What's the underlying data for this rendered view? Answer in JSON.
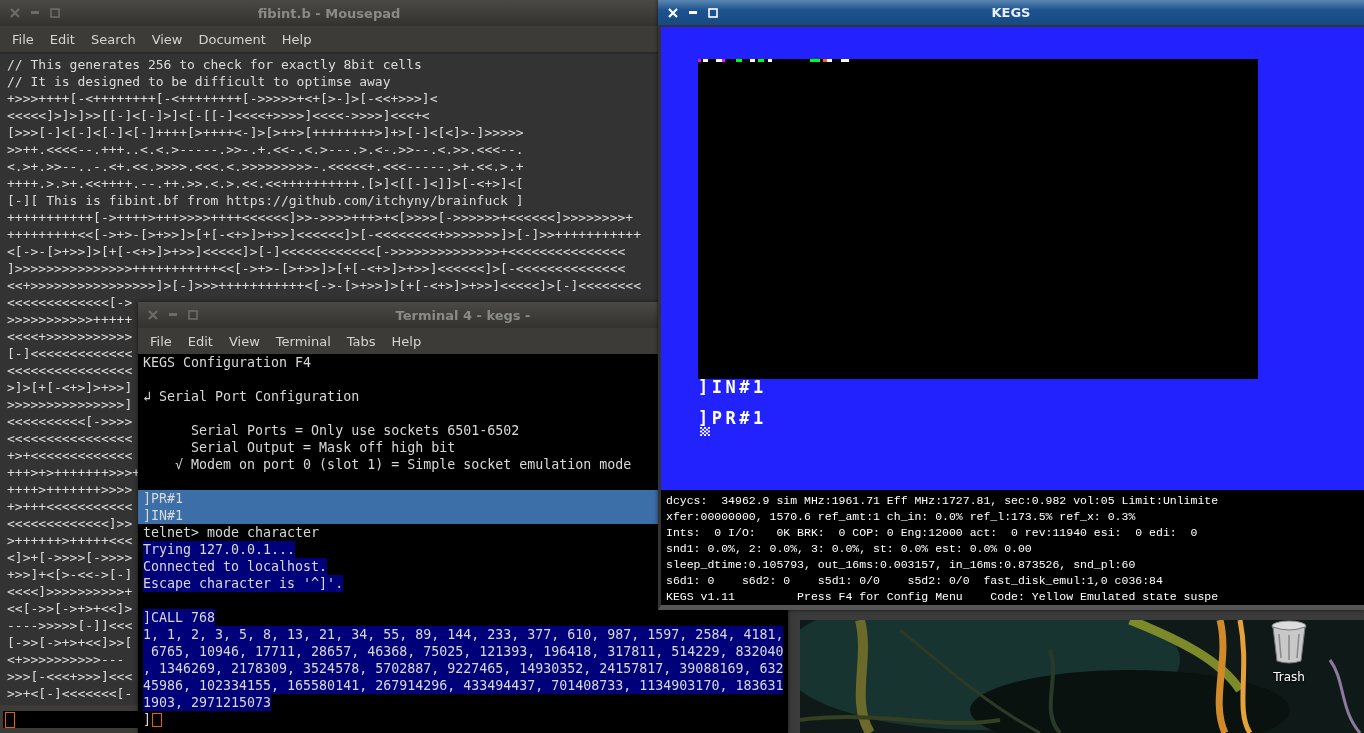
{
  "editor_window": {
    "title": "fibint.b - Mousepad",
    "active": false,
    "menu": [
      "File",
      "Edit",
      "Search",
      "View",
      "Document",
      "Help"
    ],
    "lines": [
      "// This generates 256 to check for exactly 8bit cells",
      "// It is designed to be difficult to optimse away",
      "+>>>++++[-<++++++++[-<++++++++[->>>>>+<+[>-]>[-<<+>>>]<",
      "<<<<<]>]>]>>[[-]<[-]>]<[-[[-]<<<<+>>>>]<<<<->>>>]<<<+<",
      "[>>>[-]<[-]<[-]<[-]++++[>++++<-]>[>++>[++++++++>]+>[-]<[<]>-]>>>>>",
      ">>++.<<<<--.+++..<.<.>-----.>>-.+.<<-.<.>---.>.<-.>>--.<.>>.<<<--.",
      "<.>+.>>--..-.<+.<<.>>>>.<<<.<.>>>>>>>>>-.<<<<<+.<<<-----.>+.<<.>.+",
      "++++.>.>+.<<++++.--.++.>>.<.>.<<.<<++++++++++.[>]<[[-]<]]>[-<+>]<[",
      "[-][ This is fibint.bf from https://github.com/itchyny/brainfuck ]",
      "+++++++++++[->++++>+++>>>>++++<<<<<<]>>->>>>+++>+<[>>>>[->>>>>>+<<<<<<]>>>>>>>>+",
      "+++++++++<<[->+>-[>+>>]>[+[-<+>]>+>>]<<<<<<]>[-<<<<<<<<+>>>>>>>]>[-]>>+++++++++++",
      "<[->-[>+>>]>[+[-<+>]>+>>]<<<<<]>[-]<<<<<<<<<<<<[->>>>>>>>>>>>>>+<<<<<<<<<<<<<<<",
      "]>>>>>>>>>>>>>>>+++++++++++<<[->+>-[>+>>]>[+[-<+>]>+>>]<<<<<<]>[-<<<<<<<<<<<<<<",
      "<<+>>>>>>>>>>>>>>>>]>[-]>>>+++++++++++<[->-[>+>>]>[+[-<+>]>+>>]<<<<<]>[-]<<<<<<<<",
      "<<<<<<<<<<<<<[->",
      ">>>>>>>>>>>+++++",
      "<<<<+>>>>>>>>>>>",
      "[-]<<<<<<<<<<<<<",
      "<<<<<<<<<<<<<<<<",
      ">]>[+[-<+>]>+>>]",
      ">>>>>>>>>>>>>>>]",
      "<<<<<<<<<<[->>>>",
      "<<<<<<<<<<<<<<<<",
      "+>+<<<<<<<<<<<<<",
      "+++>+>+++++++>>>+",
      "++++>+++++++>>>>",
      "+>+++<<<<<<<<<<<",
      "<<<<<<<<<<<<<]>>",
      ">++++++>+++++<<<",
      "<]>+[->>>>[->>>>",
      "+>>]+<[>-<<->[-]",
      "<<<<]>>>>>>>>>>+",
      "<<[->>[->+>+<<]>",
      "---->>>>>[-]]<<<",
      "[->>[->+>+<<]>>[",
      "<+>>>>>>>>>>---",
      ">>>[-<<<+>>>]<<<",
      ">>+<[-]<<<<<<<[-"
    ]
  },
  "terminal_window": {
    "title": "Terminal 4 - kegs -",
    "active": false,
    "menu": [
      "File",
      "Edit",
      "View",
      "Terminal",
      "Tabs",
      "Help"
    ],
    "lines": [
      {
        "kind": "plain",
        "text": "KEGS Configuration F4"
      },
      {
        "kind": "blank"
      },
      {
        "kind": "plain",
        "text": "↲ Serial Port Configuration"
      },
      {
        "kind": "blank"
      },
      {
        "kind": "plain",
        "text": "      Serial Ports = Only use sockets 6501-6502"
      },
      {
        "kind": "plain",
        "text": "      Serial Output = Mask off high bit"
      },
      {
        "kind": "plain",
        "text": "    √ Modem on port 0 (slot 1) = Simple socket emulation mode"
      },
      {
        "kind": "blank"
      },
      {
        "kind": "selected",
        "text": "]PR#1"
      },
      {
        "kind": "selected",
        "text": "]IN#1"
      },
      {
        "kind": "plain",
        "text": "telnet> mode character"
      },
      {
        "kind": "marked",
        "text": "Trying 127.0.0.1..."
      },
      {
        "kind": "marked",
        "text": "Connected to localhost."
      },
      {
        "kind": "marked",
        "text": "Escape character is '^]'."
      },
      {
        "kind": "blank"
      },
      {
        "kind": "marked",
        "text": "]CALL 768"
      },
      {
        "kind": "marked",
        "text": "1, 1, 2, 3, 5, 8, 13, 21, 34, 55, 89, 144, 233, 377, 610, 987, 1597, 2584, 4181,"
      },
      {
        "kind": "marked",
        "text": " 6765, 10946, 17711, 28657, 46368, 75025, 121393, 196418, 317811, 514229, 832040"
      },
      {
        "kind": "marked",
        "text": ", 1346269, 2178309, 3524578, 5702887, 9227465, 14930352, 24157817, 39088169, 632"
      },
      {
        "kind": "marked",
        "text": "45986, 102334155, 165580141, 267914296, 433494437, 701408733, 1134903170, 183631"
      },
      {
        "kind": "marked",
        "text": "1903, 2971215073"
      },
      {
        "kind": "prompt",
        "text": "]"
      }
    ]
  },
  "emulator_window": {
    "title": "KEGS",
    "active": true,
    "screen_lines": [
      "]IN#1",
      "]PR#1"
    ],
    "status_lines": [
      "dcycs:  34962.9 sim MHz:1961.71 Eff MHz:1727.81, sec:0.982 vol:05 Limit:Unlimite",
      "xfer:00000000, 1570.6 ref_amt:1 ch_in: 0.0% ref_l:173.5% ref_x: 0.3%",
      "Ints:  0 I/O:   0K BRK:  0 COP: 0 Eng:12000 act:  0 rev:11940 esi:  0 edi:  0",
      "snd1: 0.0%, 2: 0.0%, 3: 0.0%, st: 0.0% est: 0.0% 0.00",
      "sleep_dtime:0.105793, out_16ms:0.003157, in_16ms:0.873526, snd_pl:60",
      "s6d1: 0    s6d2: 0    s5d1: 0/0    s5d2: 0/0  fast_disk_emul:1,0 c036:84",
      "KEGS v1.11         Press F4 for Config Menu    Code: Yellow Emulated state suspe"
    ]
  },
  "desktop": {
    "icons": [
      {
        "label": "Trash"
      }
    ]
  }
}
